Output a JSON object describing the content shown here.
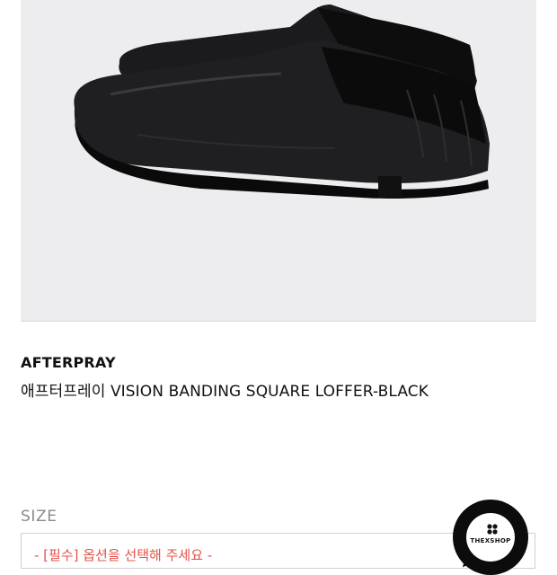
{
  "product": {
    "brand": "AFTERPRAY",
    "name": "애프터프레이 VISION BANDING SQUARE LOFFER-BLACK",
    "image_icon": "product-photo-black-loafers"
  },
  "options": {
    "size_label": "SIZE",
    "size_select_value": "- [필수] 옵션을 선택해 주세요 -"
  },
  "badge": {
    "text": "THEXSHOP",
    "icon": "chat-bubble-logo-icon"
  },
  "colors": {
    "image_background": "#ededf0",
    "required_text": "#e4524a",
    "badge": "#0c0c0c"
  }
}
